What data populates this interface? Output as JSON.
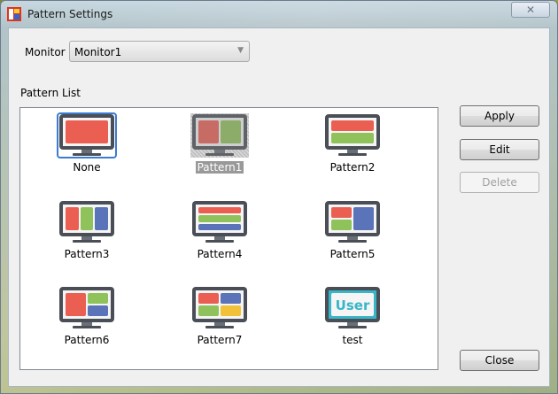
{
  "window": {
    "title": "Pattern Settings",
    "close_glyph": "✕"
  },
  "monitor": {
    "label": "Monitor",
    "selected": "Monitor1"
  },
  "pattern_list": {
    "label": "Pattern List",
    "items": [
      {
        "label": "None"
      },
      {
        "label": "Pattern1"
      },
      {
        "label": "Pattern2"
      },
      {
        "label": "Pattern3"
      },
      {
        "label": "Pattern4"
      },
      {
        "label": "Pattern5"
      },
      {
        "label": "Pattern6"
      },
      {
        "label": "Pattern7"
      },
      {
        "label": "test"
      }
    ]
  },
  "buttons": {
    "apply": "Apply",
    "edit": "Edit",
    "delete": "Delete",
    "close": "Close"
  },
  "user_icon_text": "User",
  "colors": {
    "red": "#ea5f52",
    "green": "#8fc25a",
    "blue": "#5b73b8",
    "yellow": "#f2c13a",
    "cyan": "#38b6c8"
  }
}
